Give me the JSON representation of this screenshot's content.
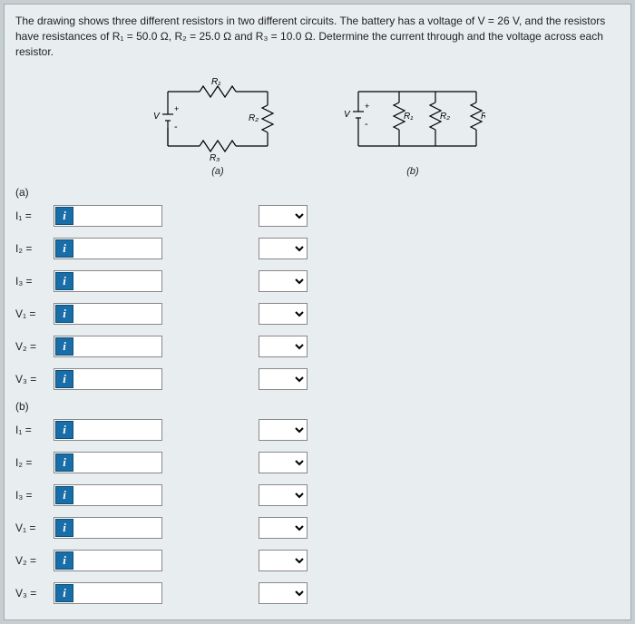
{
  "problem": {
    "text": "The drawing shows three different resistors in two different circuits. The battery has a voltage of V = 26 V, and the resistors have resistances of R₁ = 50.0 Ω, R₂ = 25.0 Ω and R₃ = 10.0 Ω. Determine the current through and the voltage across each resistor."
  },
  "circuit_labels": {
    "V": "V",
    "R1": "R₁",
    "R2": "R₂",
    "R3": "R₃",
    "plus": "+",
    "minus": "−",
    "a": "(a)",
    "b": "(b)"
  },
  "info_button": "i",
  "sections": {
    "a": {
      "label": "(a)",
      "rows": [
        {
          "var": "I₁ ="
        },
        {
          "var": "I₂ ="
        },
        {
          "var": "I₃ ="
        },
        {
          "var": "V₁ ="
        },
        {
          "var": "V₂ ="
        },
        {
          "var": "V₃ ="
        }
      ]
    },
    "b": {
      "label": "(b)",
      "rows": [
        {
          "var": "I₁ ="
        },
        {
          "var": "I₂ ="
        },
        {
          "var": "I₃ ="
        },
        {
          "var": "V₁ ="
        },
        {
          "var": "V₂ ="
        },
        {
          "var": "V₃ ="
        }
      ]
    }
  }
}
